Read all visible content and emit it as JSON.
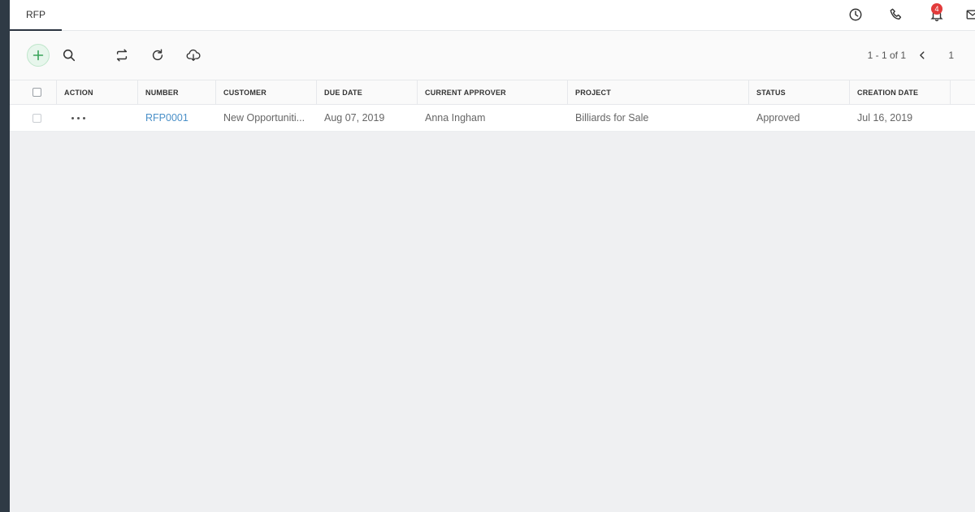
{
  "tabs": [
    {
      "label": "RFP",
      "active": true
    }
  ],
  "header": {
    "notifications_count": "4",
    "icons": [
      "clock-icon",
      "phone-icon",
      "bell-icon",
      "mail-icon"
    ]
  },
  "toolbar": {
    "icons": [
      "add-icon",
      "search-icon",
      "swap-icon",
      "refresh-icon",
      "cloud-download-icon"
    ],
    "pager_range": "1 - 1 of 1",
    "page_number": "1"
  },
  "table": {
    "columns": [
      "ACTION",
      "NUMBER",
      "CUSTOMER",
      "DUE DATE",
      "CURRENT APPROVER",
      "PROJECT",
      "STATUS",
      "CREATION DATE"
    ],
    "rows": [
      {
        "number": "RFP0001",
        "customer": "New Opportuniti...",
        "due_date": "Aug 07, 2019",
        "current_approver": "Anna Ingham",
        "project": "Billiards for Sale",
        "status": "Approved",
        "creation_date": "Jul 16, 2019"
      }
    ]
  },
  "colors": {
    "accent_link": "#4a90c8",
    "add_button_bg": "#e7f6ec",
    "badge": "#e23b3b",
    "rail": "#2f3a45",
    "background": "#eff0f2"
  }
}
